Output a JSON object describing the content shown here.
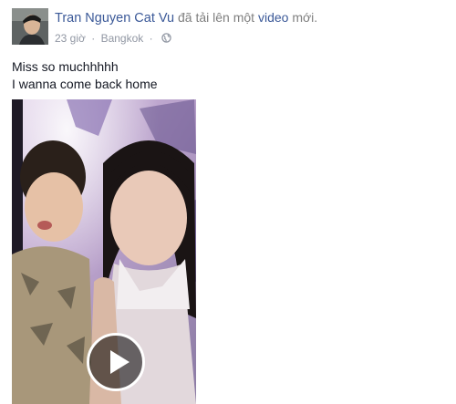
{
  "post": {
    "author": "Tran Nguyen Cat Vu",
    "action_prefix": "đã tải lên một",
    "action_link": "video",
    "action_suffix": "mới.",
    "time": "23 giờ",
    "separator": "·",
    "location": "Bangkok",
    "separator2": "·",
    "privacy_icon": "globe-icon",
    "text_line1": "Miss so muchhhhh",
    "text_line2": "I wanna come back home"
  },
  "video": {
    "play_icon": "play-icon"
  },
  "colors": {
    "link": "#3b5998",
    "meta": "#9197a3",
    "text": "#141823"
  }
}
